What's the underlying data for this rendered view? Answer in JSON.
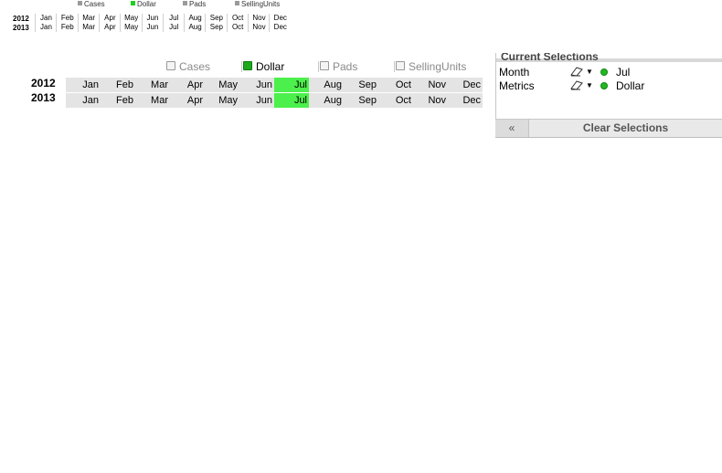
{
  "mini_preview": {
    "metrics": [
      {
        "label": "Cases",
        "selected": false
      },
      {
        "label": "Dollar",
        "selected": true
      },
      {
        "label": "Pads",
        "selected": false
      },
      {
        "label": "SellingUnits",
        "selected": false
      }
    ],
    "years": [
      "2012",
      "2013"
    ],
    "months": [
      "Jan",
      "Feb",
      "Mar",
      "Apr",
      "May",
      "Jun",
      "Jul",
      "Aug",
      "Sep",
      "Oct",
      "Nov",
      "Dec"
    ],
    "selected_month": "Jul"
  },
  "metrics": [
    {
      "label": "Cases",
      "selected": false
    },
    {
      "label": "Dollar",
      "selected": true
    },
    {
      "label": "Pads",
      "selected": false
    },
    {
      "label": "SellingUnits",
      "selected": false
    }
  ],
  "years": [
    "2012",
    "2013"
  ],
  "months": [
    "Jan",
    "Feb",
    "Mar",
    "Apr",
    "May",
    "Jun",
    "Jul",
    "Aug",
    "Sep",
    "Oct",
    "Nov",
    "Dec"
  ],
  "selected_month": "Jul",
  "colors": {
    "selected_green": "#4cf04c",
    "row_gray": "#e4e4e4"
  },
  "current_selections": {
    "title": "Current Selections",
    "rows": [
      {
        "field": "Month",
        "value": "Jul"
      },
      {
        "field": "Metrics",
        "value": "Dollar"
      }
    ],
    "back_icon": "«",
    "clear_label": "Clear Selections"
  }
}
